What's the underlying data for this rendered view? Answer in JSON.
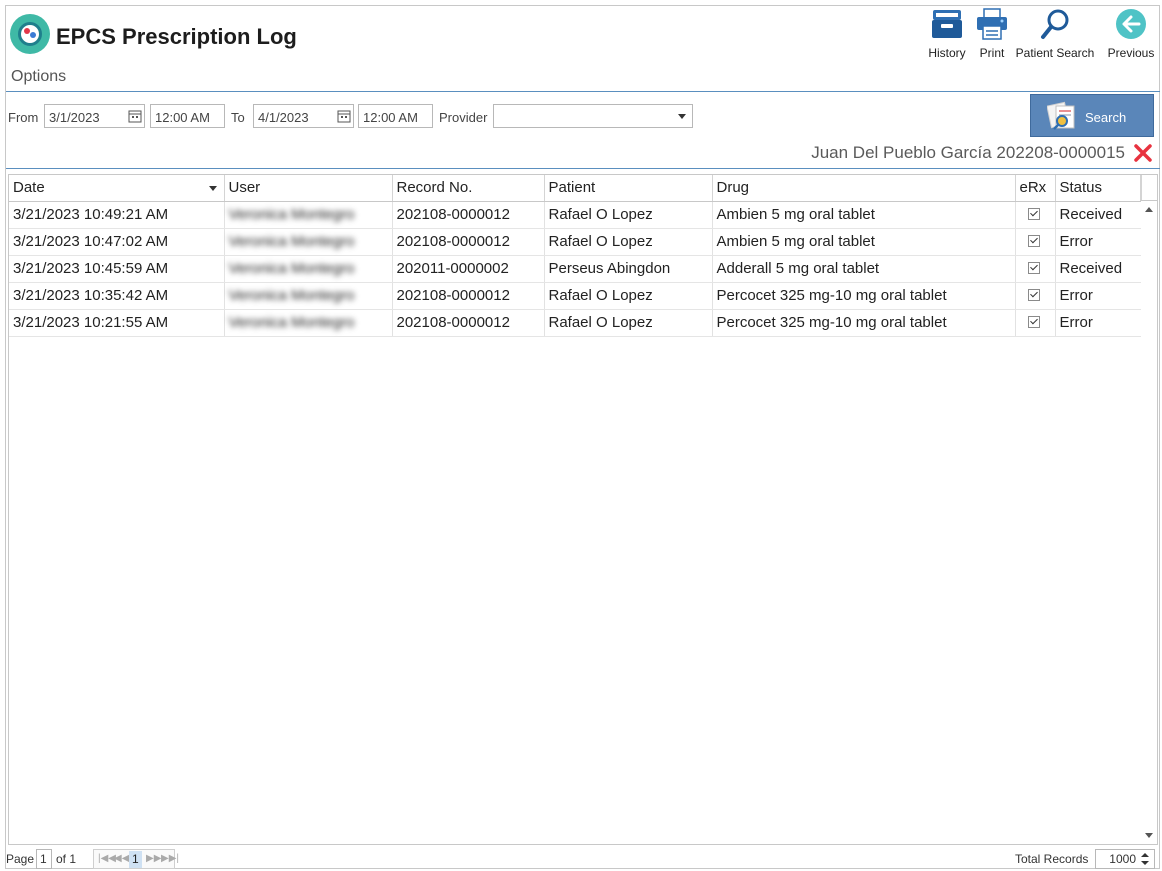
{
  "app": {
    "title": "EPCS Prescription Log",
    "options_label": "Options"
  },
  "toolbar": {
    "history": "History",
    "print": "Print",
    "patient_search": "Patient Search",
    "previous": "Previous"
  },
  "filters": {
    "from_label": "From",
    "from_date": "3/1/2023",
    "from_time": "12:00 AM",
    "to_label": "To",
    "to_date": "4/1/2023",
    "to_time": "12:00 AM",
    "provider_label": "Provider",
    "provider_value": "",
    "search_label": "Search"
  },
  "patient": {
    "display": "Juan Del Pueblo García 202208-0000015"
  },
  "grid": {
    "columns": [
      "Date",
      "User",
      "Record No.",
      "Patient",
      "Drug",
      "eRx",
      "Status"
    ],
    "rows": [
      {
        "date": "3/21/2023 10:49:21 AM",
        "user": "Veronica Montegro",
        "record": "202108-0000012",
        "patient": "Rafael O Lopez",
        "drug": "Ambien 5 mg oral tablet",
        "erx": true,
        "status": "Received"
      },
      {
        "date": "3/21/2023 10:47:02 AM",
        "user": "Veronica Montegro",
        "record": "202108-0000012",
        "patient": "Rafael O Lopez",
        "drug": "Ambien 5 mg oral tablet",
        "erx": true,
        "status": "Error"
      },
      {
        "date": "3/21/2023 10:45:59 AM",
        "user": "Veronica Montegro",
        "record": "202011-0000002",
        "patient": "Perseus Abingdon",
        "drug": "Adderall 5 mg oral tablet",
        "erx": true,
        "status": "Received"
      },
      {
        "date": "3/21/2023 10:35:42 AM",
        "user": "Veronica Montegro",
        "record": "202108-0000012",
        "patient": "Rafael O Lopez",
        "drug": "Percocet 325 mg-10 mg oral tablet",
        "erx": true,
        "status": "Error"
      },
      {
        "date": "3/21/2023 10:21:55 AM",
        "user": "Veronica Montegro",
        "record": "202108-0000012",
        "patient": "Rafael O Lopez",
        "drug": "Percocet 325 mg-10 mg oral tablet",
        "erx": true,
        "status": "Error"
      }
    ]
  },
  "pager": {
    "page_label": "Page",
    "page_value": "1",
    "of_label": "of 1",
    "current": "1",
    "total_records_label": "Total Records",
    "page_size": "1000"
  },
  "colors": {
    "accent": "#5a86b9",
    "divider": "#5a8fbf",
    "close": "#e8323f"
  }
}
